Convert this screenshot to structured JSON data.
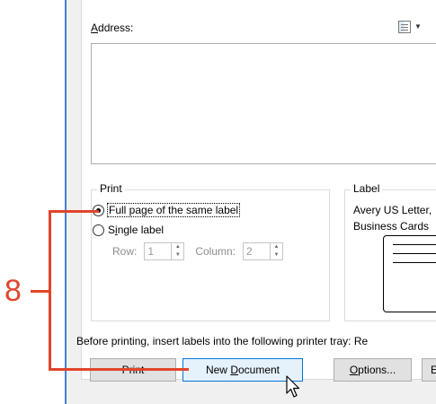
{
  "address": {
    "label_prefix": "A",
    "label_rest": "ddress:",
    "book_icon": "address-book-icon",
    "caret": "▼"
  },
  "print_group": {
    "title": "Print",
    "options": [
      {
        "label": "Full page of the same label",
        "checked": true
      },
      {
        "label_prefix": "S",
        "label_mid": "i",
        "label_rest": "ngle label",
        "checked": false
      }
    ],
    "row_label": "Row:",
    "row_value": "1",
    "column_label": "Column:",
    "column_value": "2"
  },
  "label_group": {
    "title": "Label",
    "line1": "Avery US Letter,",
    "line2": "Business Cards"
  },
  "tray_instruction": "Before printing, insert labels into the following printer tray: Re",
  "buttons": {
    "print": "Print",
    "new_document_prefix": "New ",
    "new_document_ul": "D",
    "new_document_rest": "ocument",
    "options_ul": "O",
    "options_rest": "ptions...",
    "partial": "E"
  },
  "callout": {
    "number": "8",
    "color": "#e0452b"
  },
  "colors": {
    "window_border": "#3f7fd8",
    "hover_button_bg": "#e5f1fb",
    "hover_button_border": "#0078d7"
  }
}
